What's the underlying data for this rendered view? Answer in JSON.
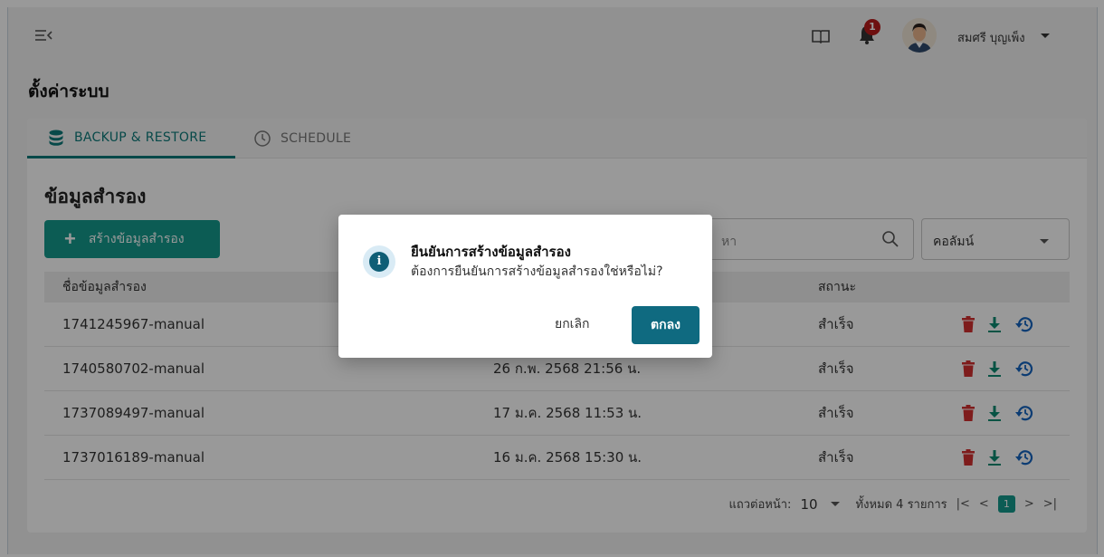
{
  "header": {
    "notification_count": "1",
    "username": "สมศรี บุญเพ็ง"
  },
  "page": {
    "title": "ตั้งค่าระบบ"
  },
  "tabs": [
    {
      "label": "BACKUP & RESTORE",
      "icon": "database-icon",
      "active": true
    },
    {
      "label": "SCHEDULE",
      "icon": "clock-icon",
      "active": false
    }
  ],
  "backup": {
    "section_title": "ข้อมูลสำรอง",
    "create_button": "สร้างข้อมูลสำรอง",
    "search_placeholder": "ค้นหา",
    "search_visible_fragment": "หา",
    "column_select": "คอลัมน์"
  },
  "table": {
    "headers": {
      "name": "ชื่อข้อมูลสำรอง",
      "date": "",
      "status": "สถานะ"
    },
    "rows": [
      {
        "name": "1741245967-manual",
        "date": "",
        "status": "สำเร็จ"
      },
      {
        "name": "1740580702-manual",
        "date": "26 ก.พ. 2568 21:56 น.",
        "status": "สำเร็จ"
      },
      {
        "name": "1737089497-manual",
        "date": "17 ม.ค. 2568 11:53 น.",
        "status": "สำเร็จ"
      },
      {
        "name": "1737016189-manual",
        "date": "16 ม.ค. 2568 15:30 น.",
        "status": "สำเร็จ"
      }
    ],
    "action_icons": [
      "trash-icon",
      "download-icon",
      "restore-icon"
    ]
  },
  "pagination": {
    "rows_per_page_label": "แถวต่อหน้า:",
    "rows_per_page": "10",
    "total_label": "ทั้งหมด 4 รายการ",
    "first": "|<",
    "prev": "<",
    "current_page": "1",
    "next": ">",
    "last": ">|"
  },
  "dialog": {
    "title": "ยืนยันการสร้างข้อมูลสำรอง",
    "message": "ต้องการยืนยันการสร้างข้อมูลสำรองใช่หรือไม่?",
    "cancel": "ยกเลิก",
    "ok": "ตกลง",
    "icon": "info-icon"
  },
  "colors": {
    "primary": "#159a8d",
    "dialog_ok": "#0f6a80",
    "danger": "#d32f2f",
    "restore": "#1565c0"
  }
}
